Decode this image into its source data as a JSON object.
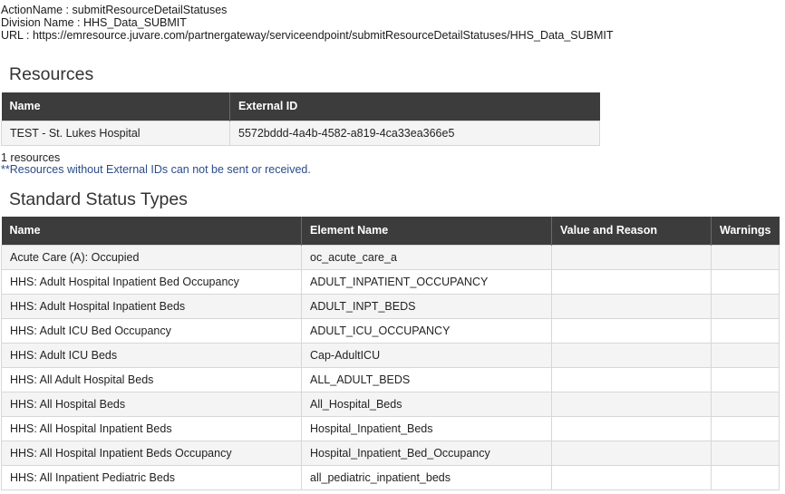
{
  "meta": {
    "action_name": "ActionName : submitResourceDetailStatuses",
    "division_name": "Division Name : HHS_Data_SUBMIT",
    "url": "URL : https://emresource.juvare.com/partnergateway/serviceendpoint/submitResourceDetailStatuses/HHS_Data_SUBMIT"
  },
  "resources": {
    "title": "Resources",
    "columns": [
      "Name",
      "External ID"
    ],
    "rows": [
      [
        "TEST - St. Lukes Hospital",
        "5572bddd-4a4b-4582-a819-4ca33ea366e5"
      ]
    ],
    "count_text": "1 resources",
    "note": "**Resources without External IDs can not be sent or received."
  },
  "status_types": {
    "title": "Standard Status Types",
    "columns": [
      "Name",
      "Element Name",
      "Value and Reason",
      "Warnings"
    ],
    "rows": [
      [
        "Acute Care (A): Occupied",
        "oc_acute_care_a",
        "",
        ""
      ],
      [
        "HHS: Adult Hospital Inpatient Bed Occupancy",
        "ADULT_INPATIENT_OCCUPANCY",
        "",
        ""
      ],
      [
        "HHS: Adult Hospital Inpatient Beds",
        "ADULT_INPT_BEDS",
        "",
        ""
      ],
      [
        "HHS: Adult ICU Bed Occupancy",
        "ADULT_ICU_OCCUPANCY",
        "",
        ""
      ],
      [
        "HHS: Adult ICU Beds",
        "Cap-AdultICU",
        "",
        ""
      ],
      [
        "HHS: All Adult Hospital Beds",
        "ALL_ADULT_BEDS",
        "",
        ""
      ],
      [
        "HHS: All Hospital Beds",
        "All_Hospital_Beds",
        "",
        ""
      ],
      [
        "HHS: All Hospital Inpatient Beds",
        "Hospital_Inpatient_Beds",
        "",
        ""
      ],
      [
        "HHS: All Hospital Inpatient Beds Occupancy",
        "Hospital_Inpatient_Bed_Occupancy",
        "",
        ""
      ],
      [
        "HHS: All Inpatient Pediatric Beds",
        "all_pediatric_inpatient_beds",
        "",
        ""
      ]
    ]
  }
}
